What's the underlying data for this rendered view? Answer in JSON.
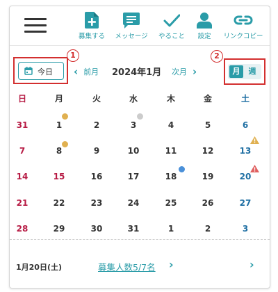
{
  "toolbar": {
    "items": [
      {
        "label": "募集する",
        "icon": "add-document-icon"
      },
      {
        "label": "メッセージ",
        "icon": "message-icon"
      },
      {
        "label": "やること",
        "icon": "check-icon"
      },
      {
        "label": "設定",
        "icon": "person-icon"
      },
      {
        "label": "リンクコピー",
        "icon": "link-icon"
      }
    ]
  },
  "calendar_header": {
    "today_label": "今日",
    "prev_label": "前月",
    "title": "2024年1月",
    "next_label": "次月",
    "view_month": "月",
    "view_week": "週",
    "annotation_1": "1",
    "annotation_2": "2"
  },
  "weekdays": [
    "日",
    "月",
    "火",
    "水",
    "木",
    "金",
    "土"
  ],
  "weeks": [
    [
      "31",
      "1",
      "2",
      "3",
      "4",
      "5",
      "6"
    ],
    [
      "7",
      "8",
      "9",
      "10",
      "11",
      "12",
      "13"
    ],
    [
      "14",
      "15",
      "16",
      "17",
      "18",
      "19",
      "20"
    ],
    [
      "21",
      "22",
      "23",
      "24",
      "25",
      "26",
      "27"
    ],
    [
      "28",
      "29",
      "30",
      "31",
      "1",
      "2",
      "3"
    ]
  ],
  "markers": {
    "holiday_color": "#b71c45",
    "saturday_color": "#1f6fa3",
    "accent": "#2a9ca8",
    "dot_gold": "#e0b050",
    "dot_gray": "#cccccc",
    "dot_blue": "#4a90d9",
    "warn_gold": "#e0b050",
    "warn_red": "#e06060"
  },
  "footer": {
    "date_label": "1月20日(土)",
    "recruit_link": "募集人数5/7名"
  }
}
